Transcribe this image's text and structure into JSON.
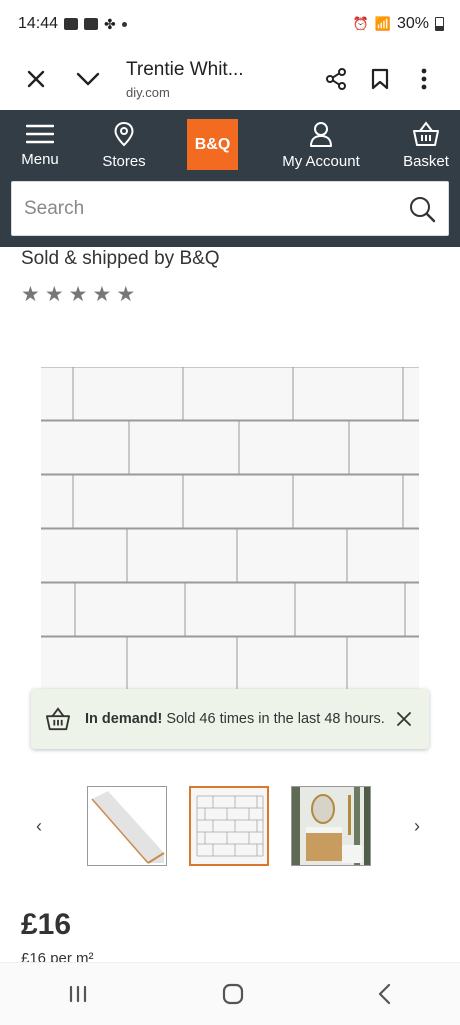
{
  "status_bar": {
    "time": "14:44",
    "battery": "30%"
  },
  "browser": {
    "title": "Trentie Whit...",
    "domain": "diy.com"
  },
  "nav": {
    "menu_label": "Menu",
    "stores_label": "Stores",
    "logo_text": "B&Q",
    "account_label": "My Account",
    "basket_label": "Basket",
    "logo_color": "#f26b21",
    "bar_color": "#333d45"
  },
  "search": {
    "placeholder": "Search"
  },
  "product": {
    "sold_by": "Sold & shipped by B&Q",
    "rating_stars": 5,
    "price": "£16",
    "per_unit": "£16 per m²"
  },
  "banner": {
    "bold": "In demand!",
    "text": " Sold 46 times in the last 48 hours."
  },
  "gallery": {
    "prev_icon": "chevron-left-icon",
    "next_icon": "chevron-right-icon",
    "selected_index": 1
  }
}
